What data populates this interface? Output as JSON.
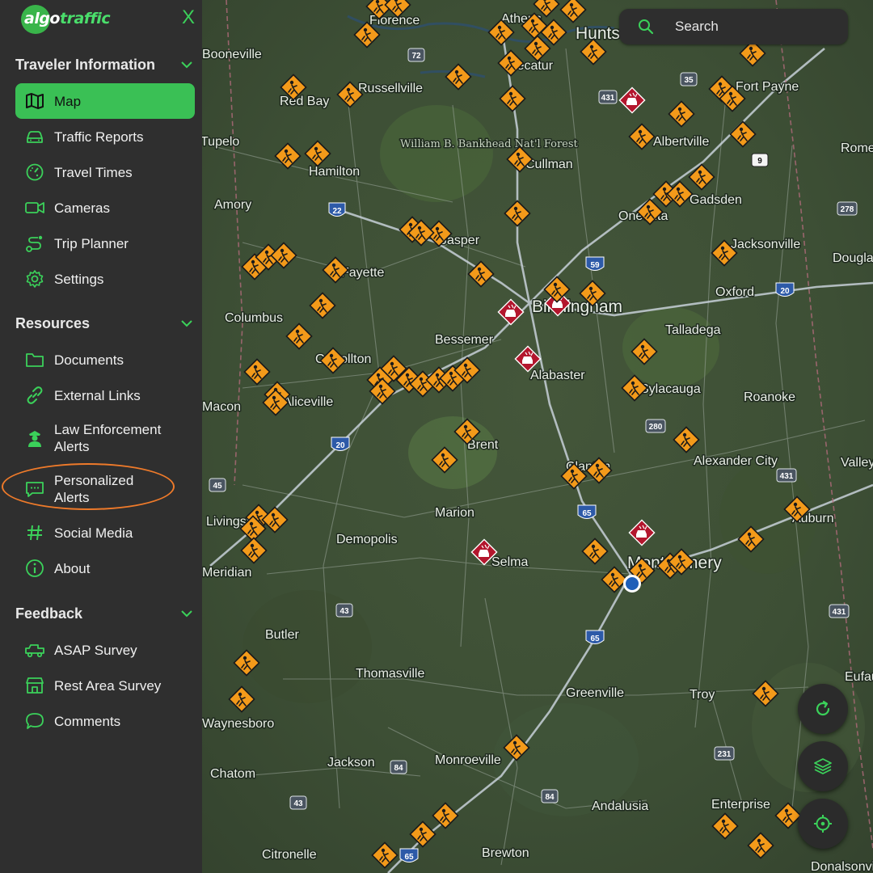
{
  "brand": {
    "part1": "algo",
    "part2": "traffic"
  },
  "close_label": "X",
  "sections": [
    {
      "title": "Traveler Information",
      "items": [
        {
          "label": "Map",
          "icon": "map-icon",
          "active": true
        },
        {
          "label": "Traffic Reports",
          "icon": "car-icon"
        },
        {
          "label": "Travel Times",
          "icon": "speedometer-icon"
        },
        {
          "label": "Cameras",
          "icon": "video-camera-icon"
        },
        {
          "label": "Trip Planner",
          "icon": "route-icon"
        },
        {
          "label": "Settings",
          "icon": "gear-icon"
        }
      ]
    },
    {
      "title": "Resources",
      "items": [
        {
          "label": "Documents",
          "icon": "folder-icon"
        },
        {
          "label": "External Links",
          "icon": "link-icon"
        },
        {
          "label": "Law Enforcement\nAlerts",
          "icon": "police-officer-icon"
        },
        {
          "label": "Personalized\nAlerts",
          "icon": "chat-bubble-icon"
        },
        {
          "label": "Social Media",
          "icon": "hashtag-icon"
        },
        {
          "label": "About",
          "icon": "info-icon"
        }
      ]
    },
    {
      "title": "Feedback",
      "items": [
        {
          "label": "ASAP Survey",
          "icon": "truck-icon"
        },
        {
          "label": "Rest Area Survey",
          "icon": "rest-area-icon"
        },
        {
          "label": "Comments",
          "icon": "comment-icon"
        }
      ]
    }
  ],
  "search": {
    "placeholder": "Search"
  },
  "map": {
    "places": [
      "Florence",
      "Athens",
      "Huntsville",
      "Decatur",
      "Booneville",
      "Russellville",
      "Red Bay",
      "Fort Payne",
      "William B. Bankhead Nat'l Forest",
      "Albertville",
      "Tupelo",
      "Hamilton",
      "Cullman",
      "Rome",
      "Amory",
      "Gadsden",
      "Jasper",
      "Oneonta",
      "Jacksonville",
      "Douglas",
      "Fayette",
      "Oxford",
      "Birmingham",
      "Columbus",
      "Talladega",
      "Bessemer",
      "Carrollton",
      "Alabaster",
      "Sylacauga",
      "Roanoke",
      "Macon",
      "Aliceville",
      "Brent",
      "Alexander City",
      "Clanton",
      "Valley",
      "Marion",
      "Livingston",
      "Auburn",
      "Demopolis",
      "Selma",
      "Montgomery",
      "Meridian",
      "Butler",
      "Thomasville",
      "Greenville",
      "Troy",
      "Eufaula",
      "Waynesboro",
      "Jackson",
      "Monroeville",
      "Chatom",
      "Andalusia",
      "Enterprise",
      "Citronelle",
      "Brewton",
      "Donalsonville"
    ],
    "shields": [
      "72",
      "35",
      "431",
      "9",
      "278",
      "22",
      "59",
      "20",
      "280",
      "20",
      "45",
      "65",
      "431",
      "43",
      "65",
      "431",
      "231",
      "84",
      "84",
      "43",
      "65",
      "431"
    ]
  },
  "colors": {
    "accent": "#3ac055",
    "construction": "#f39a1a",
    "incident": "#b3162d",
    "location_dot": "#1f5fb8",
    "annotation": "#ee7a2a"
  }
}
